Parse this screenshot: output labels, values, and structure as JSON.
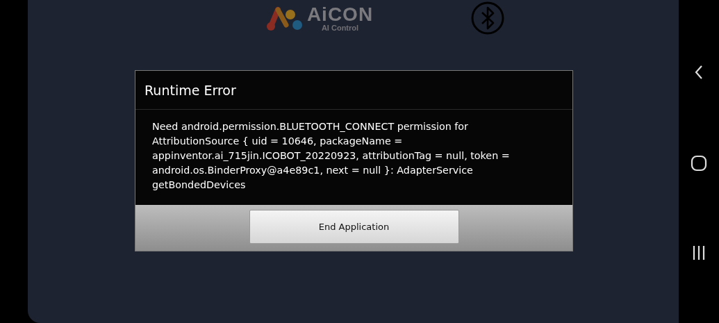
{
  "app": {
    "logo_title": "AiCON",
    "logo_subtitle": "AI Control"
  },
  "dialog": {
    "title": "Runtime Error",
    "message": "Need android.permission.BLUETOOTH_CONNECT permission for AttributionSource { uid = 10646, packageName = appinventor.ai_715jin.ICOBOT_20220923, attributionTag = null, token = android.os.BinderProxy@a4e89c1, next = null }: AdapterService getBondedDevices",
    "button": "End Application"
  }
}
